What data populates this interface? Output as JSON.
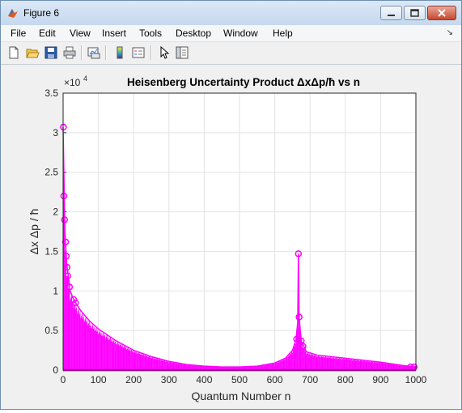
{
  "window": {
    "title": "Figure 6",
    "icon": "matlab-logo-icon",
    "controls": [
      "minimize-icon",
      "maximize-icon",
      "close-icon"
    ]
  },
  "menu": {
    "items": [
      "File",
      "Edit",
      "View",
      "Insert",
      "Tools",
      "Desktop",
      "Window",
      "Help"
    ],
    "overflow_arrow": "↘"
  },
  "toolbar": {
    "icons": [
      "new-figure-icon",
      "open-file-icon",
      "save-icon",
      "print-icon",
      "link-plot-icon",
      "insert-colorbar-icon",
      "insert-legend-icon",
      "edit-plot-pointer-icon",
      "show-plot-tools-icon"
    ]
  },
  "chart_data": {
    "type": "line",
    "title": "Heisenberg Uncertainty Product ΔxΔp/ħ vs n",
    "xlabel": "Quantum Number n",
    "ylabel": "Δx Δp / ħ",
    "y_exponent_label": "×10",
    "y_exponent_power": "4",
    "xlim": [
      0,
      1000
    ],
    "ylim": [
      0,
      35000
    ],
    "xticks": [
      "0",
      "100",
      "200",
      "300",
      "400",
      "500",
      "600",
      "700",
      "800",
      "900",
      "1000"
    ],
    "yticks": [
      "0",
      "0.5",
      "1",
      "1.5",
      "2",
      "2.5",
      "3",
      "3.5"
    ],
    "grid": true,
    "series_color": "#ff00ff",
    "markers": [
      {
        "x": 1,
        "y": 30700
      },
      {
        "x": 2,
        "y": 22000
      },
      {
        "x": 4,
        "y": 19000
      },
      {
        "x": 7,
        "y": 16200
      },
      {
        "x": 9,
        "y": 14400
      },
      {
        "x": 11,
        "y": 13000
      },
      {
        "x": 13,
        "y": 11900
      },
      {
        "x": 18,
        "y": 10500
      },
      {
        "x": 30,
        "y": 8900
      },
      {
        "x": 35,
        "y": 8500
      },
      {
        "x": 662,
        "y": 3900
      },
      {
        "x": 667,
        "y": 14700
      },
      {
        "x": 669,
        "y": 6700
      },
      {
        "x": 675,
        "y": 3700
      },
      {
        "x": 680,
        "y": 3000
      },
      {
        "x": 985,
        "y": 400
      },
      {
        "x": 995,
        "y": 400
      }
    ],
    "envelope": [
      {
        "x": 0,
        "y": 30700
      },
      {
        "x": 5,
        "y": 17500
      },
      {
        "x": 10,
        "y": 13500
      },
      {
        "x": 20,
        "y": 10000
      },
      {
        "x": 30,
        "y": 8900
      },
      {
        "x": 50,
        "y": 7500
      },
      {
        "x": 75,
        "y": 6200
      },
      {
        "x": 100,
        "y": 5200
      },
      {
        "x": 150,
        "y": 3700
      },
      {
        "x": 200,
        "y": 2500
      },
      {
        "x": 250,
        "y": 1700
      },
      {
        "x": 300,
        "y": 1100
      },
      {
        "x": 350,
        "y": 700
      },
      {
        "x": 400,
        "y": 500
      },
      {
        "x": 450,
        "y": 400
      },
      {
        "x": 500,
        "y": 400
      },
      {
        "x": 550,
        "y": 500
      },
      {
        "x": 600,
        "y": 900
      },
      {
        "x": 630,
        "y": 1500
      },
      {
        "x": 650,
        "y": 2500
      },
      {
        "x": 660,
        "y": 3800
      },
      {
        "x": 665,
        "y": 6000
      },
      {
        "x": 667,
        "y": 14700
      },
      {
        "x": 669,
        "y": 6700
      },
      {
        "x": 675,
        "y": 3700
      },
      {
        "x": 690,
        "y": 2300
      },
      {
        "x": 720,
        "y": 1900
      },
      {
        "x": 800,
        "y": 1500
      },
      {
        "x": 900,
        "y": 1000
      },
      {
        "x": 960,
        "y": 600
      },
      {
        "x": 1000,
        "y": 400
      }
    ]
  }
}
